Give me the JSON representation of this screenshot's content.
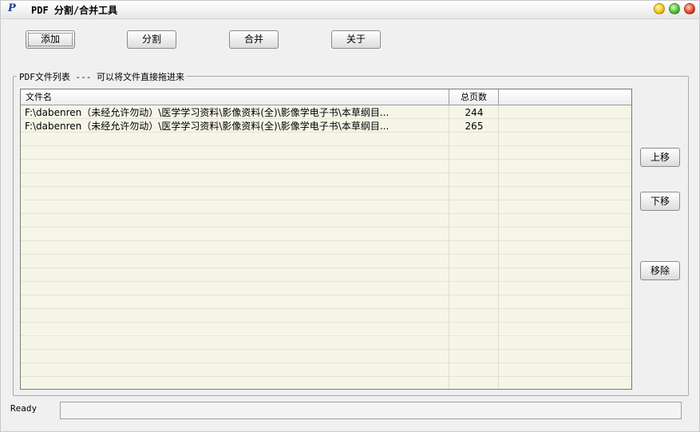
{
  "window": {
    "title": "PDF 分割/合并工具"
  },
  "toolbar": {
    "add_label": "添加",
    "split_label": "分割",
    "merge_label": "合并",
    "about_label": "关于"
  },
  "file_list": {
    "group_label": "PDF文件列表  --- 可以将文件直接拖进来",
    "columns": [
      "文件名",
      "总页数"
    ],
    "rows": [
      {
        "name": "F:\\dabenren（未经允许勿动）\\医学学习资料\\影像资料(全)\\影像学电子书\\本草纲目...",
        "pages": "244"
      },
      {
        "name": "F:\\dabenren（未经允许勿动）\\医学学习资料\\影像资料(全)\\影像学电子书\\本草纲目...",
        "pages": "265"
      }
    ]
  },
  "side_buttons": {
    "up_label": "上移",
    "down_label": "下移",
    "remove_label": "移除"
  },
  "status": {
    "text": "Ready",
    "progress": 0
  },
  "icons": [
    "app-icon",
    "minimize-icon",
    "maximize-icon",
    "close-icon"
  ],
  "colors": {
    "list_background": "#f6f6e8",
    "window_background": "#f0f0f0"
  }
}
